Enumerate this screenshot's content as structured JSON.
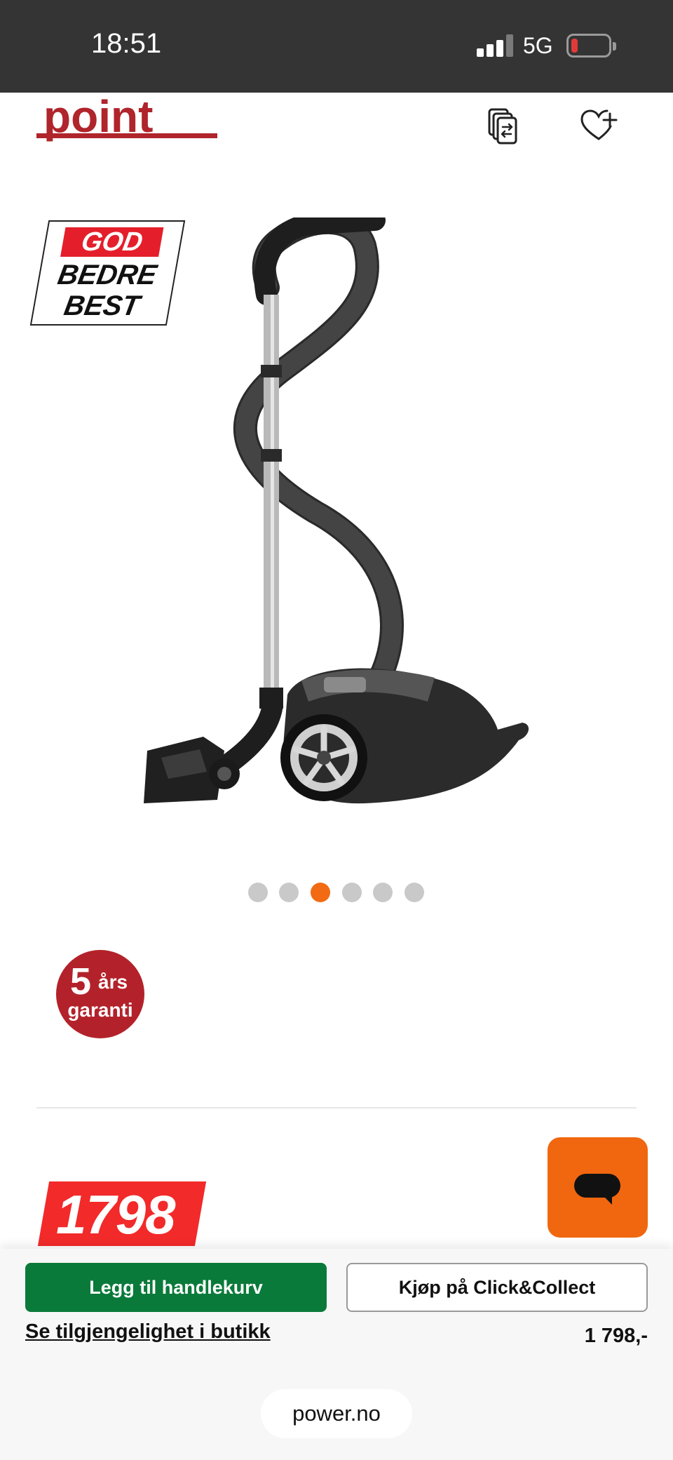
{
  "status_bar": {
    "time": "18:51",
    "network": "5G",
    "battery_level": 0.1
  },
  "header": {
    "logo_text": "point",
    "brand_color": "#b0242b",
    "icons": [
      "compare-icon",
      "wishlist-heart-plus-icon"
    ]
  },
  "badge": {
    "line1": "GOD",
    "line2": "BEDRE",
    "line3": "BEST"
  },
  "carousel": {
    "total": 6,
    "active_index": 2,
    "active_color": "#f26a12"
  },
  "warranty": {
    "number": "5",
    "unit": "års",
    "label": "garanti"
  },
  "price": {
    "amount": "1798",
    "formatted": "1 798,-"
  },
  "actions": {
    "add_to_cart": "Legg til handlekurv",
    "click_collect": "Kjøp på Click&Collect",
    "store_availability": "Se tilgjengelighet i butikk"
  },
  "browser": {
    "url": "power.no"
  },
  "colors": {
    "cart_button": "#0a7a3a",
    "chat_button": "#f0670f",
    "price_badge": "#f22a2a"
  }
}
